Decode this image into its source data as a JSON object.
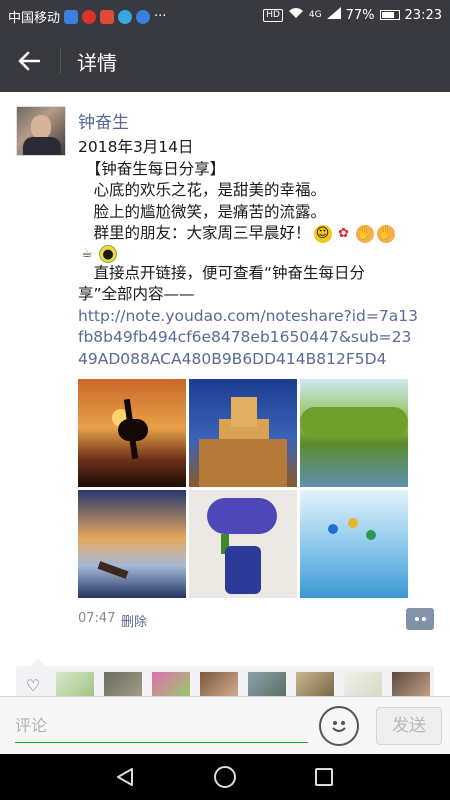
{
  "status_bar": {
    "carrier": "中国移动",
    "more": "···",
    "hd": "HD",
    "network": "4G",
    "battery_percent": 77,
    "battery_text": "77%",
    "time": "23:23"
  },
  "header": {
    "back_icon": "arrow-left-icon",
    "title": "详情"
  },
  "post": {
    "author": "钟奋生",
    "lines": [
      "2018年3月14日",
      "　【钟奋生每日分享】",
      "　心底的欢乐之花，是甜美的幸福。",
      "　脸上的尴尬微笑，是痛苦的流露。",
      "　群里的朋友：大家周三早晨好！"
    ],
    "emojis_line1": [
      "smile-emoji",
      "rose-emoji",
      "handshake-emoji",
      "pray-emoji"
    ],
    "emojis_line2": [
      "coffee-emoji",
      "dog-emoji"
    ],
    "link_intro_1": "　直接点开链接，便可查看“钟奋生每日分",
    "link_intro_2": "享”全部内容——",
    "link": "http://note.youdao.com/noteshare?id=7a13fb8b49fb494cf6e8478eb1650447&sub=2349AD088ACA480B9B6DD414B812F5D4",
    "photos": [
      "sunset-heron-photo",
      "castle-night-photo",
      "lake-trees-photo",
      "boat-sunset-photo",
      "iris-vase-photo",
      "skydivers-photo"
    ],
    "time": "07:47",
    "delete_label": "删除"
  },
  "likes": {
    "icon": "heart-icon",
    "avatar_count": 9
  },
  "comment": {
    "placeholder": "评论",
    "send_label": "发送"
  },
  "colors": {
    "header_bg": "#393a3f",
    "link": "#576b95",
    "accent_green": "#1aad19"
  }
}
